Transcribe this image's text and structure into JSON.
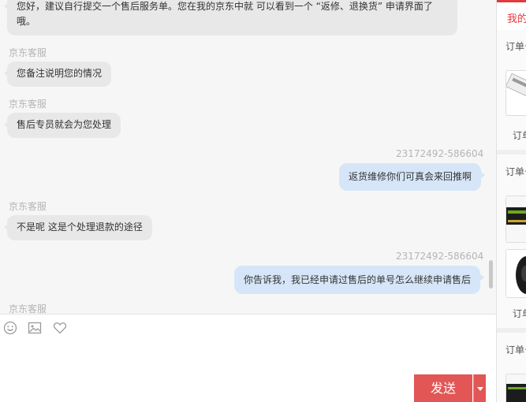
{
  "chat": {
    "messages": [
      {
        "type": "agent",
        "text_line1": "您好，建议自行提交一个售后服务单。您在我的京东中就 可以看到一个 “返修、退换货” 申请界面了",
        "text_line2": "哦。"
      },
      {
        "type": "agent",
        "sender": "京东客服",
        "text": "您备注说明您的情况"
      },
      {
        "type": "agent",
        "sender": "京东客服",
        "text": "售后专员就会为您处理"
      },
      {
        "type": "user",
        "sender": "23172492-586604",
        "text": "返货维修你们可真会来回推啊"
      },
      {
        "type": "agent",
        "sender": "京东客服",
        "text": "不是呢 这是个处理退款的途径"
      },
      {
        "type": "user",
        "sender": "23172492-586604",
        "text": "你告诉我，我已经申请过售后的单号怎么继续申请售后"
      },
      {
        "type": "agent",
        "sender": "京东客服"
      }
    ]
  },
  "composer": {
    "tools": [
      "emoji-icon",
      "image-icon",
      "heart-icon"
    ],
    "send_label": "发送"
  },
  "sidebar": {
    "tab_label": "我的",
    "order_label": "订单号",
    "order_label_short": "订单",
    "accent": "#e4393c"
  },
  "colors": {
    "send_button": "#e25656",
    "user_bubble": "#d6e6f8",
    "agent_bubble": "#e8e8e8"
  }
}
